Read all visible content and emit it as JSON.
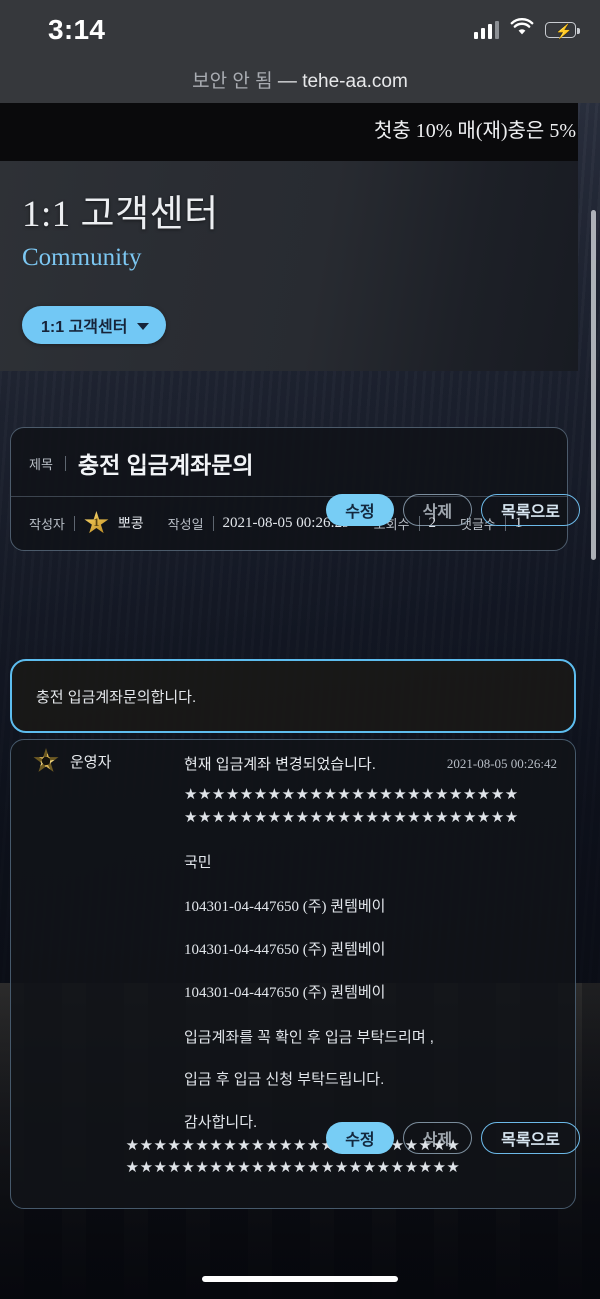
{
  "status_bar": {
    "time": "3:14",
    "signal_icon": "cellular-bars-icon",
    "wifi_icon": "wifi-icon",
    "battery_icon": "battery-charging-icon",
    "battery_bolt": "⚡"
  },
  "browser": {
    "security_label": "보안 안 됨",
    "separator": "—",
    "domain": "tehe-aa.com"
  },
  "marquee": {
    "text": "첫충 10% 매(재)충은 5%"
  },
  "header": {
    "title": "1:1 고객센터",
    "subtitle": "Community",
    "category_pill": {
      "label": "1:1 고객센터",
      "chevron_icon": "chevron-down-icon"
    }
  },
  "actions": {
    "edit": "수정",
    "delete": "삭제",
    "list": "목록으로"
  },
  "post": {
    "title_label": "제목",
    "title": "충전 입금계좌문의",
    "author_label": "작성자",
    "author_name": "뽀콩",
    "author_rank_icon": "gold-star-rank-icon",
    "author_rank": "1",
    "date_label": "작성일",
    "date": "2021-08-05 00:26:29",
    "views_label": "조회수",
    "views": "2",
    "comments_label": "댓글수",
    "comments": "1",
    "body": "충전 입금계좌문의합니다."
  },
  "reply": {
    "author_icon": "admin-emblem-icon",
    "author": "운영자",
    "subject": "현재 입금계좌 변경되었습니다.",
    "date": "2021-08-05 00:26:42",
    "stars_top_1": "★★★★★★★★★★★★★★★★★★★★★★★★",
    "stars_top_2": "★★★★★★★★★★★★★★★★★★★★★★★★",
    "bank": "국민",
    "account_1": "104301-04-447650 (주) 퀀템베이",
    "account_2": "104301-04-447650 (주) 퀀템베이",
    "account_3": "104301-04-447650 (주) 퀀템베이",
    "notice_1": "입금계좌를 꼭 확인 후 입금 부탁드리며 ,",
    "notice_2": "입금 후 입금 신청 부탁드립니다.",
    "notice_3": "감사합니다.",
    "stars_bottom_1": "★★★★★★★★★★★★★★★★★★★★★★★★",
    "stars_bottom_2": "★★★★★★★★★★★★★★★★★★★★★★★★"
  },
  "colors": {
    "accent_blue": "#72c8f5",
    "highlight_border": "#5dbdef",
    "subtitle_blue": "#7cc7f2",
    "gold": "#e3b94a",
    "battery_green": "#32d74b"
  }
}
